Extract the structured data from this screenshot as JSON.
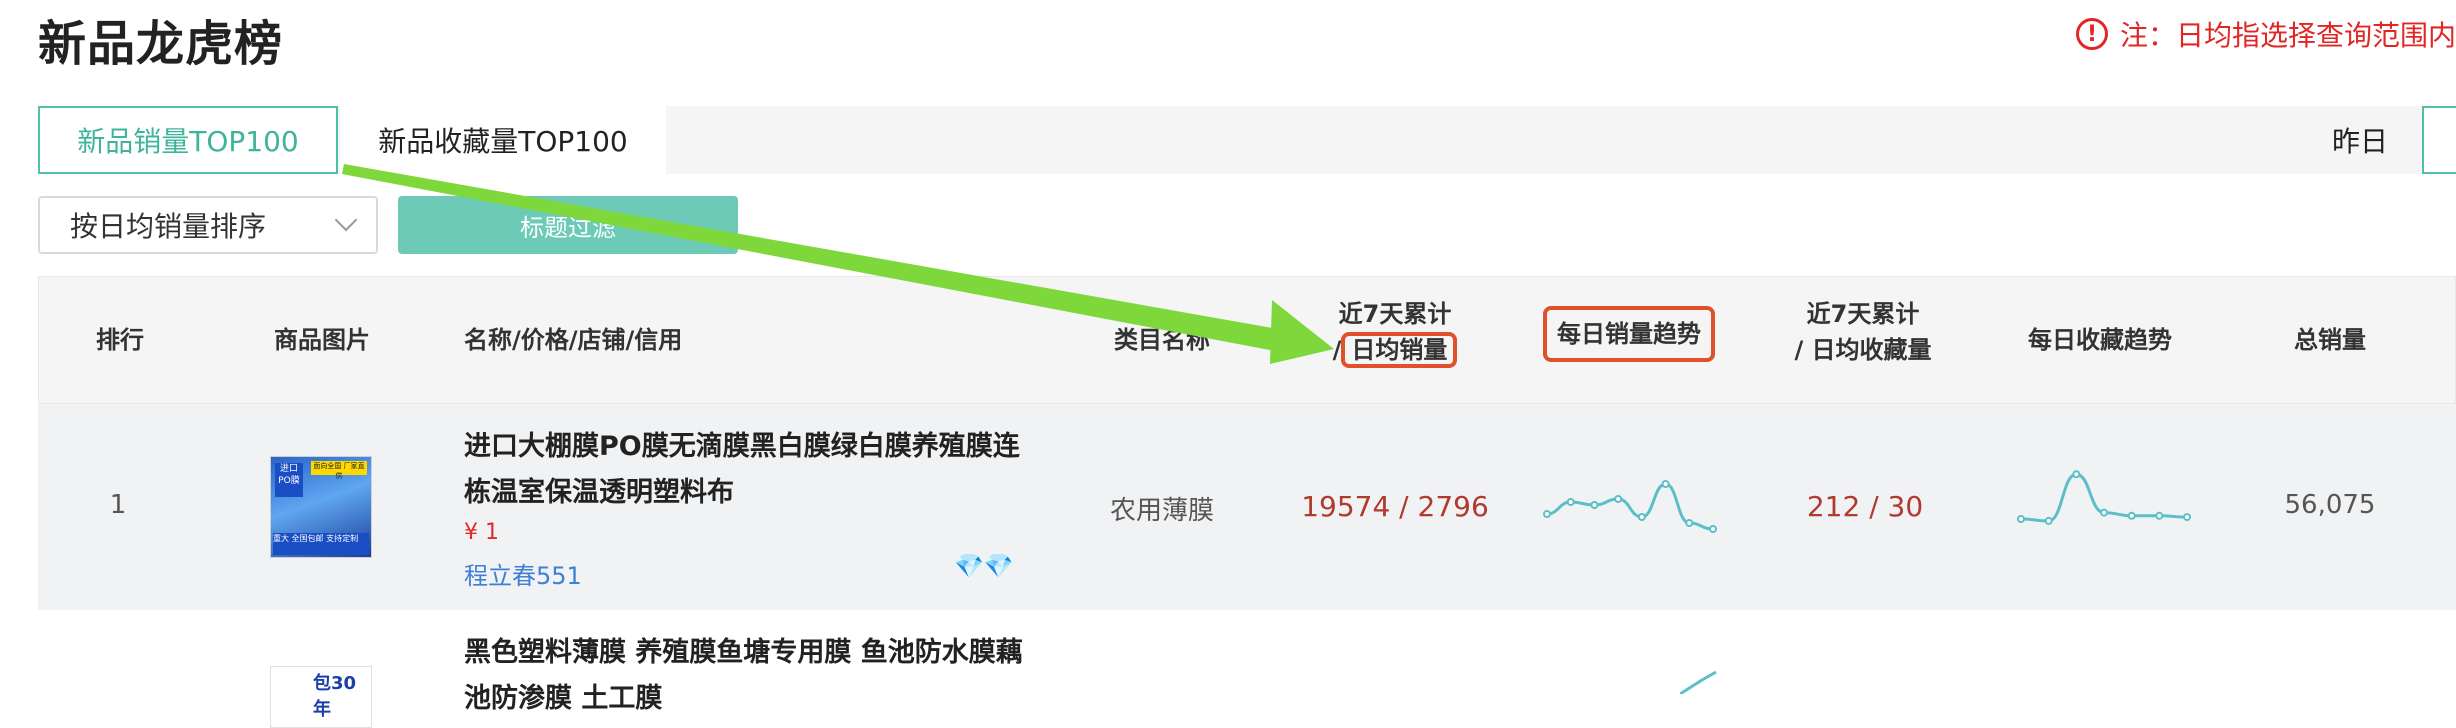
{
  "page": {
    "title": "新品龙虎榜",
    "note": "注：日均指选择查询范围内"
  },
  "tabs": {
    "active": "新品销量TOP100",
    "second": "新品收藏量TOP100",
    "date": "昨日"
  },
  "controls": {
    "sort_selected": "按日均销量排序",
    "filter_button": "标题过滤"
  },
  "table": {
    "headers": {
      "rank": "排行",
      "image": "商品图片",
      "name": "名称/价格/店铺/信用",
      "category": "类目名称",
      "sales7_line1": "近7天累计",
      "sales7_line2_prefix": "/",
      "sales7_line2_hl": "日均销量",
      "sales_trend": "每日销量趋势",
      "fav7_line1": "近7天累计",
      "fav7_line2": "/ 日均收藏量",
      "fav_trend": "每日收藏趋势",
      "total": "总销量"
    },
    "rows": [
      {
        "rank": "1",
        "name_line1": "进口大棚膜PO膜无滴膜黑白膜绿白膜养殖膜连",
        "name_line2": "栋温室保温透明塑料布",
        "price": "¥ 1",
        "shop": "程立春551",
        "credit": "💎💎",
        "category": "农用薄膜",
        "sales7": "19574 / 2796",
        "fav7": "212 / 30",
        "total": "56,075",
        "thumb_text": {
          "a": "进口PO膜",
          "b": "面向全国 厂家直供",
          "c": "重大 全国包邮 支持定制"
        },
        "sales_trend": [
          0.35,
          0.55,
          0.5,
          0.6,
          0.3,
          0.85,
          0.2,
          0.1
        ],
        "fav_trend": [
          0.25,
          0.22,
          0.95,
          0.35,
          0.3,
          0.3,
          0.28
        ]
      },
      {
        "name_line1": "黑色塑料薄膜 养殖膜鱼塘专用膜 鱼池防水膜藕",
        "name_line2": "池防渗膜 土工膜",
        "thumb_text": {
          "a": "包30年"
        }
      }
    ]
  },
  "annotation": {
    "arrow_color": "#7ed83c",
    "highlight_color": "#e0502a"
  },
  "colors": {
    "accent": "#4fc0a8",
    "sparkline": "#5bbfc8",
    "value_red": "#b03a2e",
    "note_red": "#e22626"
  }
}
